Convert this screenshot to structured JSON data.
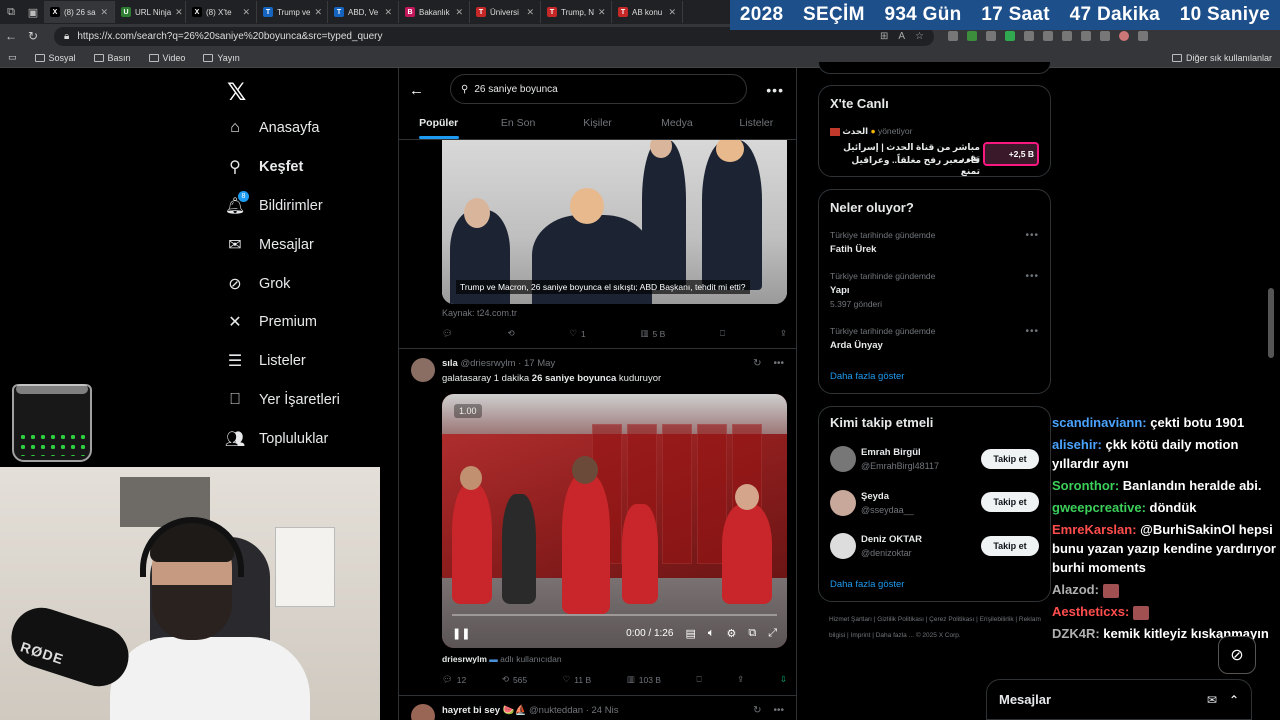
{
  "browser": {
    "tabs": [
      {
        "label": "(8) 26 sa",
        "fav": "X",
        "color": "#000000",
        "active": true
      },
      {
        "label": "URL Ninja",
        "fav": "U",
        "color": "#2e7d32",
        "active": false
      },
      {
        "label": "(8) X'te",
        "fav": "X",
        "color": "#000000",
        "active": false
      },
      {
        "label": "Trump ve",
        "fav": "T",
        "color": "#1565c0",
        "active": false
      },
      {
        "label": "ABD, Ve",
        "fav": "T",
        "color": "#1565c0",
        "active": false
      },
      {
        "label": "Bakanlık",
        "fav": "B",
        "color": "#c2185b",
        "active": false
      },
      {
        "label": "Üniversi",
        "fav": "T",
        "color": "#c62828",
        "active": false
      },
      {
        "label": "Trump, N",
        "fav": "T",
        "color": "#c62828",
        "active": false
      },
      {
        "label": "AB konu",
        "fav": "T",
        "color": "#c62828",
        "active": false
      }
    ],
    "url": "https://x.com/search?q=26%20saniye%20boyunca&src=typed_query",
    "bookmarks": [
      "Sosyal",
      "Basın",
      "Video",
      "Yayın"
    ],
    "bookmarks_right": "Diğer sık kullanılanlar"
  },
  "countdown": {
    "year": "2028",
    "label": "SEÇİM",
    "days": "934 Gün",
    "hours": "17 Saat",
    "minutes": "47 Dakika",
    "seconds": "10 Saniye"
  },
  "nav": {
    "home": "Anasayfa",
    "explore": "Keşfet",
    "notifications": "Bildirimler",
    "notifications_badge": "8",
    "messages": "Mesajlar",
    "grok": "Grok",
    "premium": "Premium",
    "lists": "Listeler",
    "bookmarks": "Yer İşaretleri",
    "communities": "Topluluklar"
  },
  "search": {
    "query": "26 saniye boyunca",
    "tabs": [
      "Popüler",
      "En Son",
      "Kişiler",
      "Medya",
      "Listeler"
    ]
  },
  "tweet1": {
    "caption": "Trump ve Macron, 26 saniye boyunca el sıkıştı; ABD Başkanı, tehdit mi etti?",
    "source": "Kaynak: t24.com.tr",
    "likes": "1",
    "views": "5 B"
  },
  "tweet2": {
    "name": "sıla",
    "handle": "@driesrwylm",
    "date": "17 May",
    "text_prefix": "galatasaray 1 dakika ",
    "text_bold": "26 saniye boyunca",
    "text_suffix": " kuduruyor",
    "speed": "1.00",
    "time": "0:00 / 1:26",
    "user_line_name": "driesrwylm",
    "user_line_rest": " adlı kullanıcıdan",
    "replies": "12",
    "retweets": "565",
    "likes": "11 B",
    "views": "103 B"
  },
  "tweet3": {
    "name": "hayret bi sey",
    "handle": "@nukteddan",
    "date": "24 Nis"
  },
  "live": {
    "title": "X'te Canlı",
    "host": "الحدث",
    "role": "yönetiyor",
    "line1": "مباشر من قناة الحدث | إسرائيل تقرر",
    "line2": "قاء معبر رفح مغلقاً.. وعراقيل تمنع",
    "count": "+2,5 B"
  },
  "trends": {
    "title": "Neler oluyor?",
    "items": [
      {
        "context": "Türkiye tarihinde gündemde",
        "name": "Fatih Ürek",
        "posts": ""
      },
      {
        "context": "Türkiye tarihinde gündemde",
        "name": "Yapı",
        "posts": "5.397 gönderi"
      },
      {
        "context": "Türkiye tarihinde gündemde",
        "name": "Arda Ünyay",
        "posts": ""
      }
    ],
    "more": "Daha fazla göster"
  },
  "follow": {
    "title": "Kimi takip etmeli",
    "users": [
      {
        "name": "Emrah Birgül",
        "handle": "@EmrahBirgl48117",
        "button": "Takip et"
      },
      {
        "name": "Şeyda",
        "handle": "@sseydaa__",
        "button": "Takip et"
      },
      {
        "name": "Deniz OKTAR",
        "handle": "@denizoktar",
        "button": "Takip et"
      }
    ],
    "more": "Daha fazla göster"
  },
  "footer": "Hizmet Şartları  |  Gizlilik Politikası  |  Çerez Politikası  |  Erişilebilirlik  |  Reklam bilgisi  |  Imprint  |  Daha fazla ...  © 2025 X Corp.",
  "chat": [
    {
      "user": "scandinaviann:",
      "color": "#4aa3ff",
      "text": " çekti botu 1901"
    },
    {
      "user": "alisehir:",
      "color": "#4aa3ff",
      "text": " çkk kötü daily motion yıllardır aynı"
    },
    {
      "user": "Soronthor:",
      "color": "#3ccf5a",
      "text": " Banlandın heralde abi."
    },
    {
      "user": "gweepcreative:",
      "color": "#3ccf5a",
      "text": " döndük"
    },
    {
      "user": "EmreKarslan:",
      "color": "#ff4d4d",
      "text": " @BurhiSakinOl hepsi bunu yazan yazıp kendine yardırıyor burhi moments"
    },
    {
      "user": "Alazod:",
      "color": "#b0b0b0",
      "text": " "
    },
    {
      "user": "Aestheticxs:",
      "color": "#ff4d4d",
      "text": " "
    },
    {
      "user": "DZK4R:",
      "color": "#b0b0b0",
      "text": " kemik kitleyiz kıskanmayın"
    }
  ],
  "webcam": {
    "mic_brand": "RØDE"
  },
  "dock": {
    "title": "Mesajlar"
  }
}
